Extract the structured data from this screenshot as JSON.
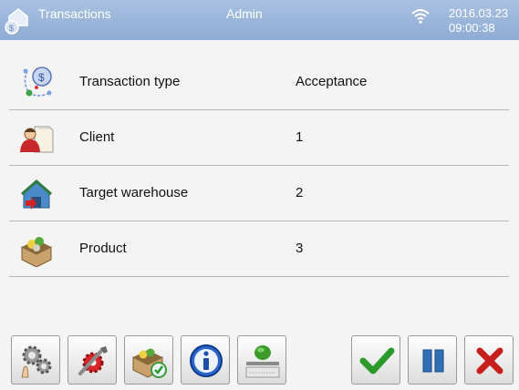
{
  "header": {
    "title": "Transactions",
    "user": "Admin",
    "date": "2016.03.23",
    "time": "09:00:38"
  },
  "rows": [
    {
      "label": "Transaction type",
      "value": "Acceptance",
      "icon": "transaction-type-icon"
    },
    {
      "label": "Client",
      "value": "1",
      "icon": "client-icon"
    },
    {
      "label": "Target warehouse",
      "value": "2",
      "icon": "warehouse-icon"
    },
    {
      "label": "Product",
      "value": "3",
      "icon": "product-icon"
    }
  ],
  "toolbar": {
    "buttons": [
      "settings-icon",
      "tools-icon",
      "product-check-icon",
      "info-icon",
      "scale-icon",
      "confirm-icon",
      "pause-icon",
      "cancel-icon"
    ]
  },
  "colors": {
    "header_bg": "#9bb5da",
    "confirm": "#2a9a2a",
    "pause": "#2f6fb4",
    "cancel": "#c81e1e"
  }
}
